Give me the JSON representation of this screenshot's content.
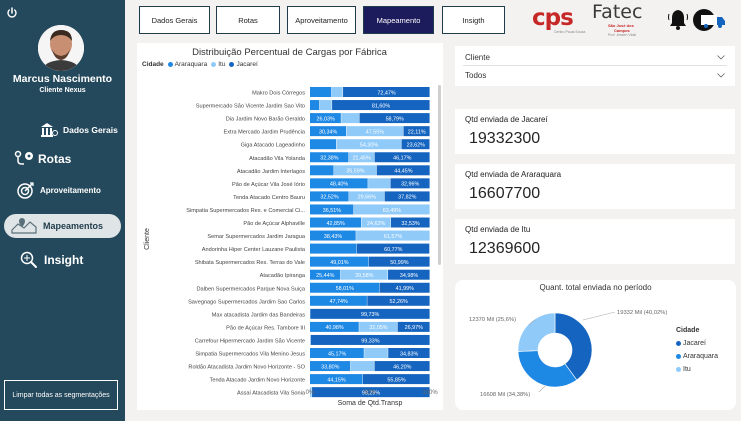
{
  "sidebar": {
    "user_name": "Marcus Nascimento",
    "user_role": "Cliente Nexus",
    "nav": [
      {
        "label": "Dados Gerais",
        "icon": "bank-icon"
      },
      {
        "label": "Rotas",
        "icon": "route-icon"
      },
      {
        "label": "Aproveitamento",
        "icon": "target-icon"
      },
      {
        "label": "Mapeamentos",
        "icon": "map-icon"
      },
      {
        "label": "Insight",
        "icon": "magnifier-icon"
      }
    ],
    "clear_label": "Limpar todas as segmentações"
  },
  "topbar": {
    "buttons": [
      "Dados Gerais",
      "Rotas",
      "Aproveitamento",
      "Mapeamento",
      "Insigth"
    ],
    "active": "Mapeamento"
  },
  "logos": {
    "cps": "cps",
    "cps_sub": "Centro Paula Souza",
    "fatec": "Fatec",
    "fatec_sub1": "São José dos",
    "fatec_sub2": "Campos",
    "fatec_sub3": "Prof. Jessen Vidal"
  },
  "colors": {
    "jacarei": "#1565c0",
    "araraquara": "#1e88e5",
    "itu": "#90caf9",
    "sidebar": "#25495c",
    "active_button": "#1c1c5c"
  },
  "filter": {
    "label": "Cliente",
    "value": "Todos"
  },
  "cards": [
    {
      "label": "Qtd enviada de Jacareí",
      "value": "19332300"
    },
    {
      "label": "Qtd enviada de Araraquara",
      "value": "16607700"
    },
    {
      "label": "Qtd enviada de Itu",
      "value": "12369600"
    }
  ],
  "chart_data": [
    {
      "type": "bar",
      "orientation": "horizontal-stacked-100",
      "title": "Distribuição Percentual de Cargas por Fábrica",
      "legend_title": "Cidade",
      "legend": [
        "Araraquara",
        "Itu",
        "Jacareí"
      ],
      "xlabel": "Soma de Qtd.Transp",
      "ylabel": "Cliente",
      "xticks": [
        "0%",
        "50%",
        "100%"
      ],
      "categories": [
        "Makro Dois Córregos",
        "Supermercado São Vicente Jardim Sao Vito",
        "Dia Jardim Novo Barão Geraldo",
        "Extra Mercado Jardim Prudência",
        "Giga Atacado Lageadinho",
        "Atacadão Vila Yolanda",
        "Atacadão Jardim Interlagos",
        "Pão de Açúcar Vila José Iório",
        "Tenda Atacado Centro Bauru",
        "Simpatia Supermercados Res. e Comercial Ci...",
        "Pão de Açúcar Alphaville",
        "Semar Supermercados Jardim Jaragua",
        "Andorinha Hiper Center Lauzane Paulista",
        "Shibata Supermercados Res. Terras do Vale",
        "Atacadão Ipiranga",
        "Dalben Supermercados Parque Nova Suiça",
        "Savegnago Supermercados Jardim Sao Carlos",
        "Max atacadista Jardim das Bandeiras",
        "Pão de Açúcar Res. Tambore III",
        "Carrefour Hipermercado Jardim São Vicente",
        "Simpatia Supermercados Vila Menino Jesus",
        "Roldão Atacadista Jardim Novo Horizonte - SO",
        "Tenda Atacado Jardim Novo Horizonte",
        "Assaí Atacadista Vila Sonia"
      ],
      "series": [
        {
          "name": "Araraquara",
          "values": [
            18.0,
            8.0,
            26.03,
            30.34,
            22.0,
            32.38,
            20.0,
            48.4,
            32.52,
            36.51,
            42.85,
            38.43,
            39.0,
            49.01,
            25.44,
            58.01,
            47.74,
            0.0,
            40.98,
            0.0,
            45.17,
            33.8,
            44.15,
            0.0
          ]
        },
        {
          "name": "Itu",
          "values": [
            9.53,
            10.4,
            15.18,
            47.55,
            54.3,
            21.45,
            35.59,
            18.64,
            29.66,
            63.49,
            24.62,
            61.57,
            0.0,
            0.0,
            39.58,
            0.0,
            0.0,
            0.27,
            32.05,
            0.67,
            20.0,
            20.0,
            0.0,
            1.71
          ]
        },
        {
          "name": "Jacareí",
          "values": [
            72.47,
            81.6,
            58.79,
            22.11,
            23.62,
            46.17,
            44.45,
            32.96,
            37.82,
            0.0,
            32.53,
            0.0,
            60.77,
            50.99,
            34.98,
            41.99,
            52.26,
            99.73,
            26.97,
            99.33,
            34.83,
            46.2,
            55.85,
            98.29
          ]
        }
      ],
      "data_labels": [
        [
          "",
          "",
          "72,47%"
        ],
        [
          "",
          "",
          "81,60%"
        ],
        [
          "26,03%",
          "",
          "58,79%"
        ],
        [
          "30,34%",
          "47,55%",
          "22,11%"
        ],
        [
          "",
          "54,30%",
          "23,62%"
        ],
        [
          "32,38%",
          "21,45%",
          "46,17%"
        ],
        [
          "",
          "35,59%",
          "44,45%"
        ],
        [
          "48,40%",
          "",
          "32,96%"
        ],
        [
          "32,52%",
          "29,66%",
          "37,82%"
        ],
        [
          "36,51%",
          "63,49%",
          ""
        ],
        [
          "42,85%",
          "24,62%",
          "32,53%"
        ],
        [
          "38,43%",
          "61,57%",
          ""
        ],
        [
          "",
          "",
          "60,77%"
        ],
        [
          "49,01%",
          "",
          "50,99%"
        ],
        [
          "25,44%",
          "39,58%",
          "34,98%"
        ],
        [
          "58,01%",
          "",
          "41,99%"
        ],
        [
          "47,74%",
          "",
          "52,26%"
        ],
        [
          "",
          "",
          "99,73%"
        ],
        [
          "40,98%",
          "32,05%",
          "26,97%"
        ],
        [
          "",
          "",
          "99,33%"
        ],
        [
          "45,17%",
          "",
          "34,83%"
        ],
        [
          "33,80%",
          "",
          "46,20%"
        ],
        [
          "44,15%",
          "",
          "55,85%"
        ],
        [
          "",
          "",
          "98,29%"
        ]
      ],
      "xlim": [
        0,
        100
      ]
    },
    {
      "type": "pie",
      "donut": true,
      "title": "Quant. total enviada no período",
      "legend_title": "Cidade",
      "legend": [
        "Jacareí",
        "Araraquara",
        "Itu"
      ],
      "slices": [
        {
          "name": "Jacareí",
          "value": 19332,
          "percent": 40.02,
          "label": "19332 Mil (40,02%)"
        },
        {
          "name": "Araraquara",
          "value": 16608,
          "percent": 34.38,
          "label": "16608 Mil (34,38%)"
        },
        {
          "name": "Itu",
          "value": 12370,
          "percent": 25.6,
          "label": "12370 Mil (25,6%)"
        }
      ]
    }
  ]
}
